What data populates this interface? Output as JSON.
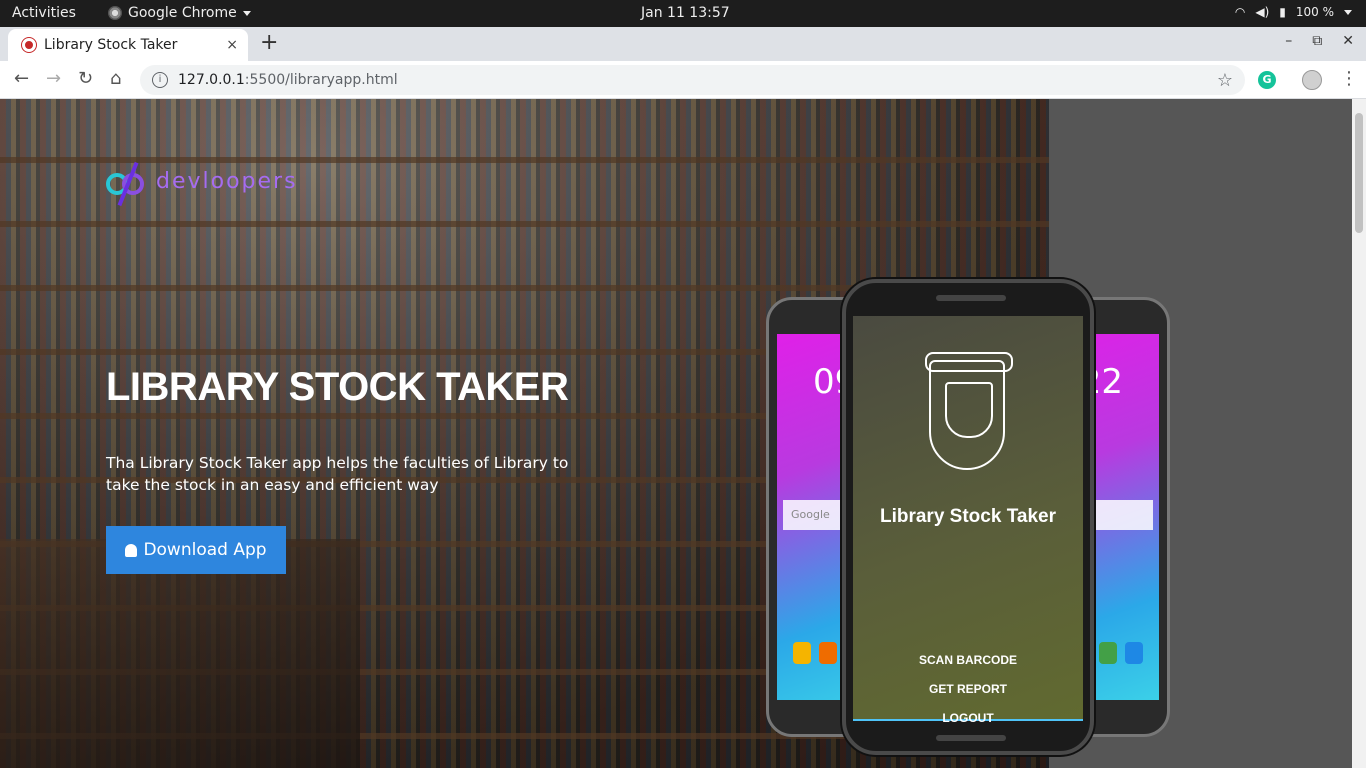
{
  "topbar": {
    "activities": "Activities",
    "app_name": "Google Chrome",
    "clock": "Jan 11  13:57",
    "battery": "100 %"
  },
  "browser": {
    "tab_title": "Library Stock Taker",
    "tab_close": "×",
    "new_tab": "+",
    "window_controls": {
      "minimize": "–",
      "restore": "⧉",
      "close": "✕"
    },
    "url_host": "127.0.0.1",
    "url_path": ":5500/libraryapp.html",
    "info_icon": "i",
    "star_icon": "☆",
    "extension_label": "G",
    "menu_icon": "⋮"
  },
  "nav": {
    "back": "←",
    "forward": "→",
    "reload": "↻",
    "home": "⌂"
  },
  "page": {
    "logo_text": "devloopers",
    "hero_title": "LIBRARY STOCK TAKER",
    "hero_description": "Tha Library Stock Taker app helps the faculties of Library to take the stock in an easy and efficient way",
    "download_label": "Download App",
    "phone": {
      "app_title": "Library Stock Taker",
      "menu": [
        "SCAN BARCODE",
        "GET REPORT",
        "LOGOUT"
      ],
      "left_time": "09",
      "right_time": "22",
      "google_label": "Google"
    }
  }
}
